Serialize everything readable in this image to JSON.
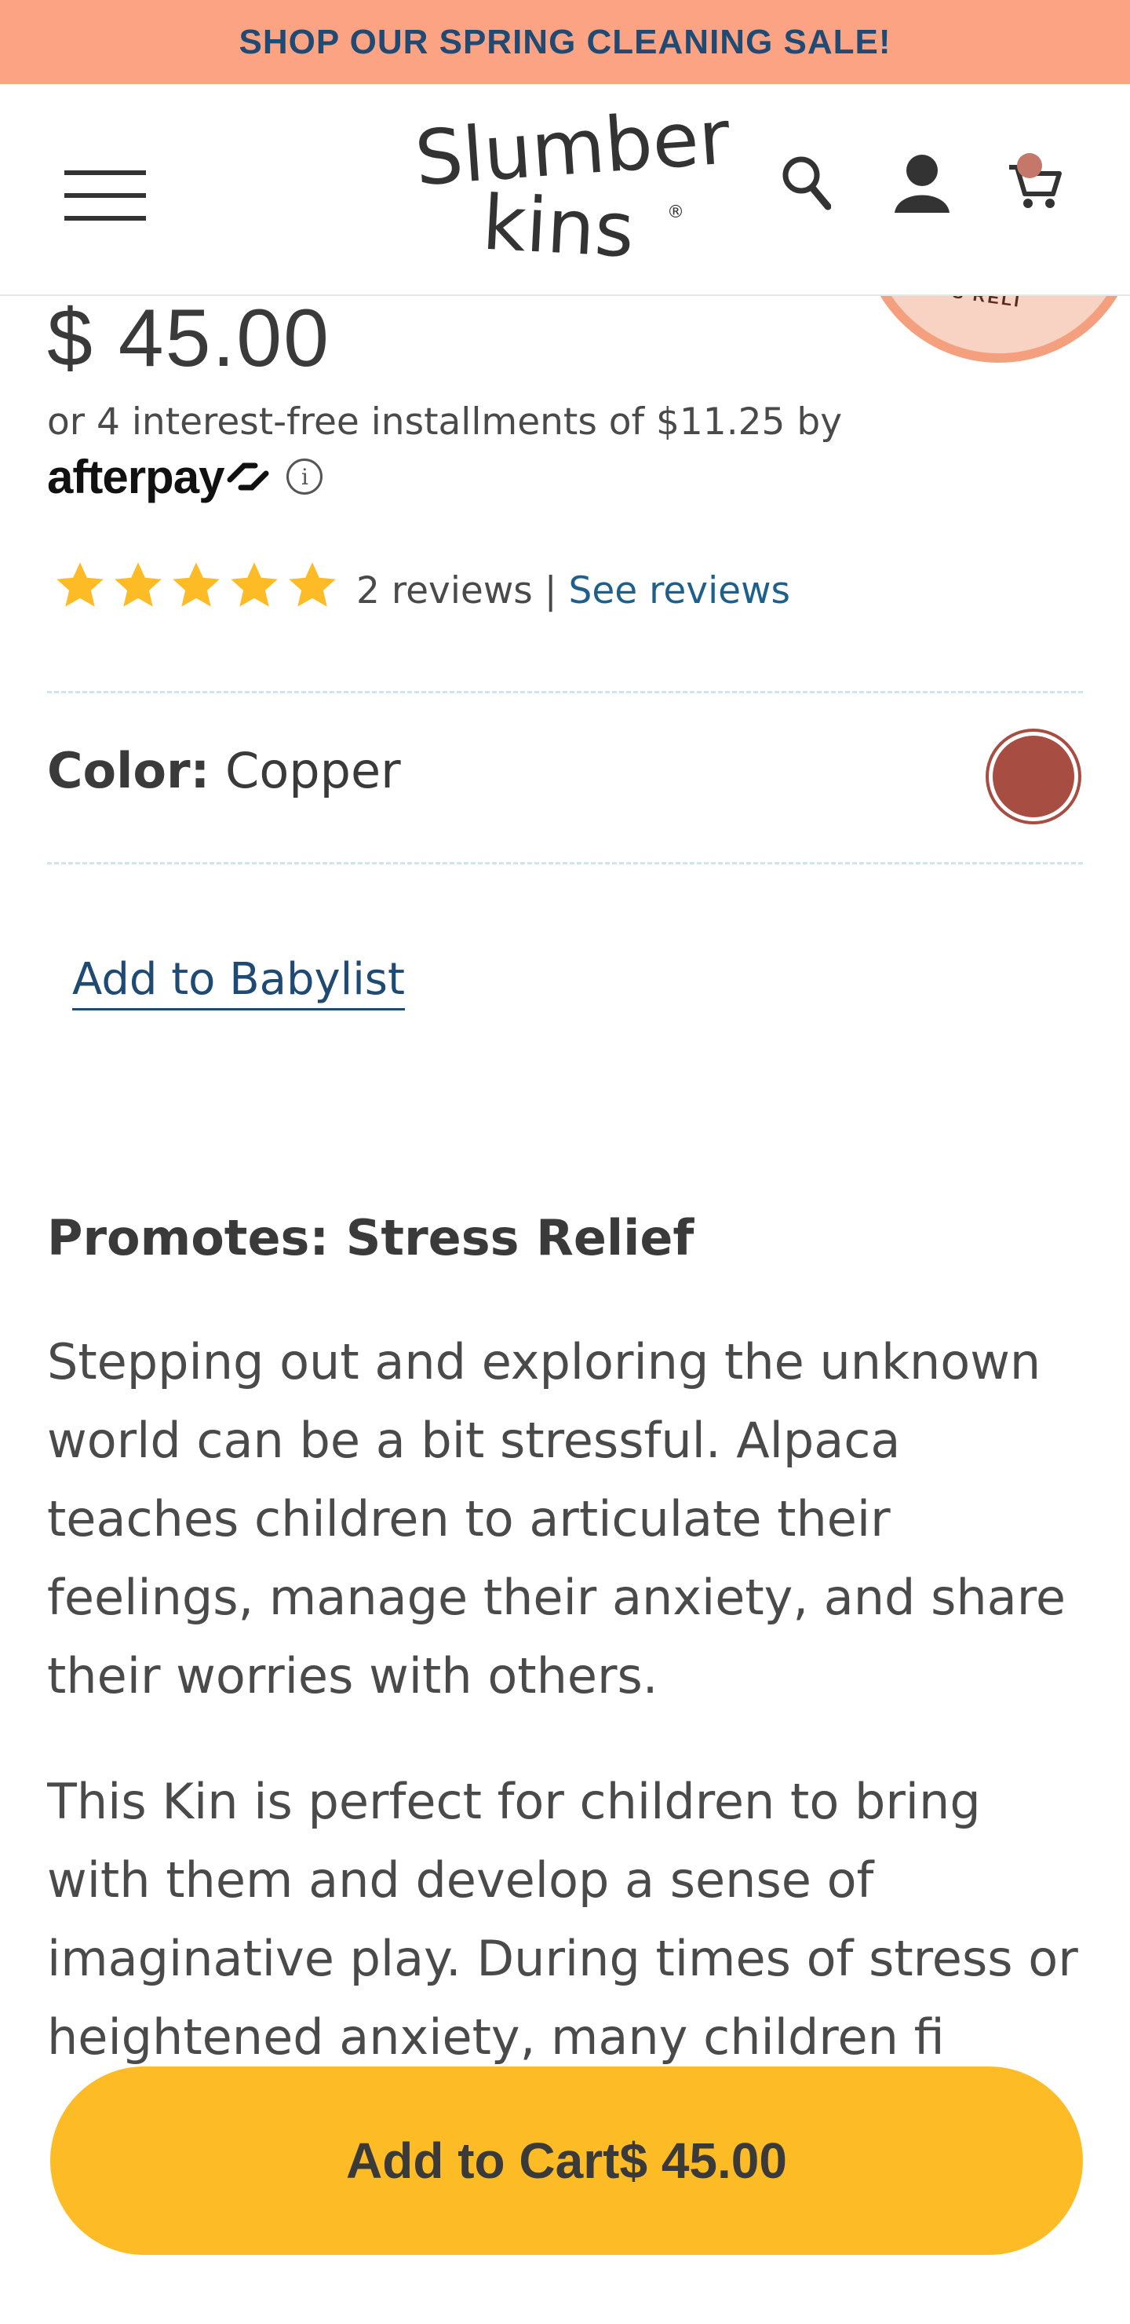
{
  "promo_banner": {
    "text": "SHOP OUR SPRING CLEANING SALE!"
  },
  "header": {
    "logo_line1": "Slumber",
    "logo_line2": "kins",
    "logo_mark": "®",
    "icons": [
      "menu-icon",
      "search-icon",
      "account-icon",
      "cart-icon"
    ]
  },
  "badge": {
    "text": "S RELI"
  },
  "product": {
    "price": "$ 45.00",
    "installments_text": "or 4 interest-free installments of $11.25 by",
    "afterpay_label": "afterpay",
    "info_glyph": "i",
    "rating": {
      "stars": 5,
      "max": 5,
      "reviews_label": "2 reviews",
      "separator": " | ",
      "see_reviews": "See reviews"
    },
    "color": {
      "label": "Color:",
      "value": "Copper",
      "swatch_hex": "#a84d42"
    },
    "babylist_link": "Add to Babylist",
    "promotes_heading": "Promotes: Stress Relief",
    "description": [
      "Stepping out and exploring the unknown world can be a bit stressful. Alpaca teaches children to articulate their feelings, manage their anxiety, and share their worries with others.",
      "This Kin is perfect for children to bring with them and develop a sense of imaginative play. During times of stress or heightened anxiety, many children fi"
    ]
  },
  "cart_button": {
    "label": "Add to Cart",
    "price": "$ 45.00"
  },
  "colors": {
    "promo_bg": "#fca384",
    "promo_text": "#1f4a73",
    "link": "#1f5f8b",
    "star": "#fdbc26",
    "cart_bg": "#fdbc26"
  }
}
